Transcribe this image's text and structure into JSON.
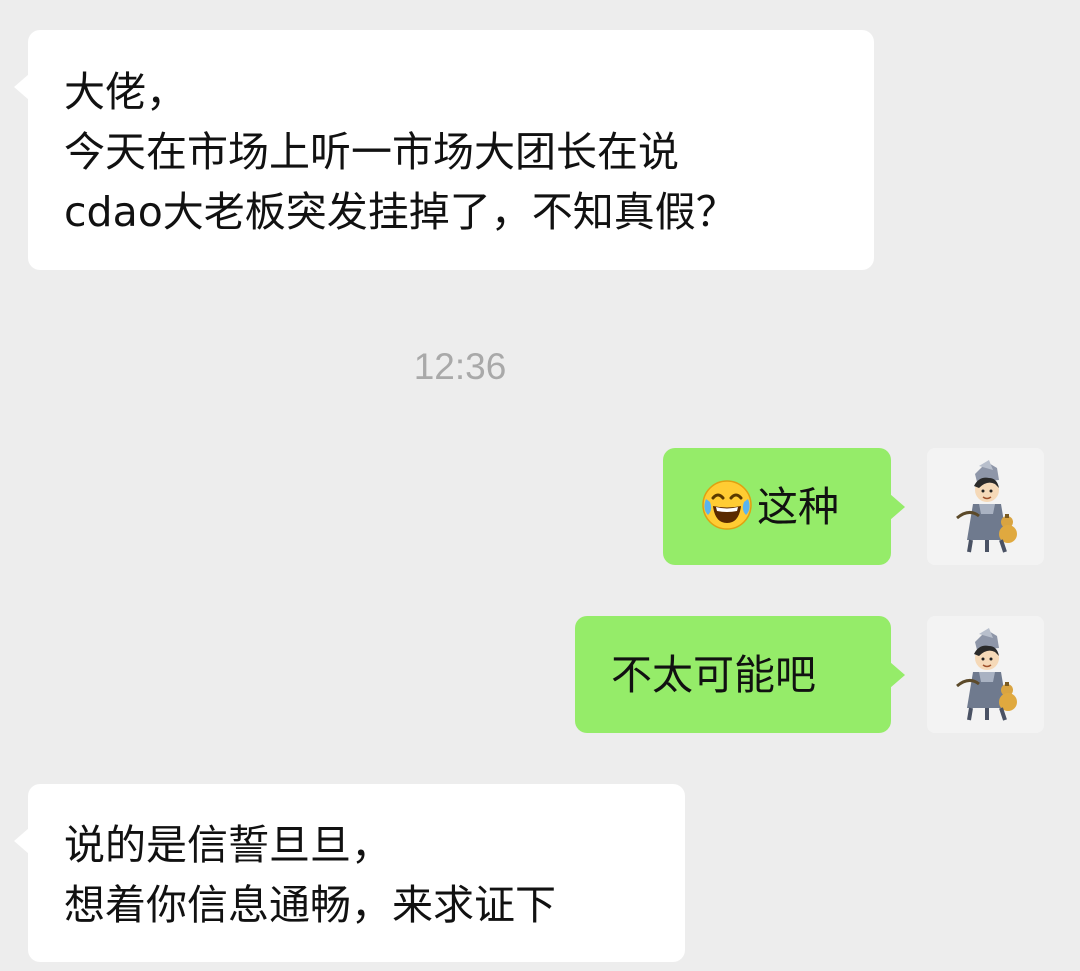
{
  "conversation": {
    "messages": [
      {
        "sender": "contact",
        "lines": [
          "大佬，",
          "今天在市场上听一市场大团长在说",
          "cdao大老板突发挂掉了，不知真假？"
        ]
      },
      {
        "sender": "self",
        "emoji": "face-with-tears-of-joy-emoji",
        "text": "这种"
      },
      {
        "sender": "self",
        "text": "不太可能吧"
      },
      {
        "sender": "contact",
        "lines": [
          "说的是信誓旦旦，",
          "想着你信息通畅，来求证下"
        ]
      }
    ],
    "timestamp": "12:36"
  },
  "self_avatar": {
    "icon": "cartoon-character-with-gourd-avatar"
  },
  "colors": {
    "background": "#ededed",
    "incoming_bubble": "#ffffff",
    "outgoing_bubble": "#95ec69",
    "timestamp_text": "#a9a9a9"
  }
}
